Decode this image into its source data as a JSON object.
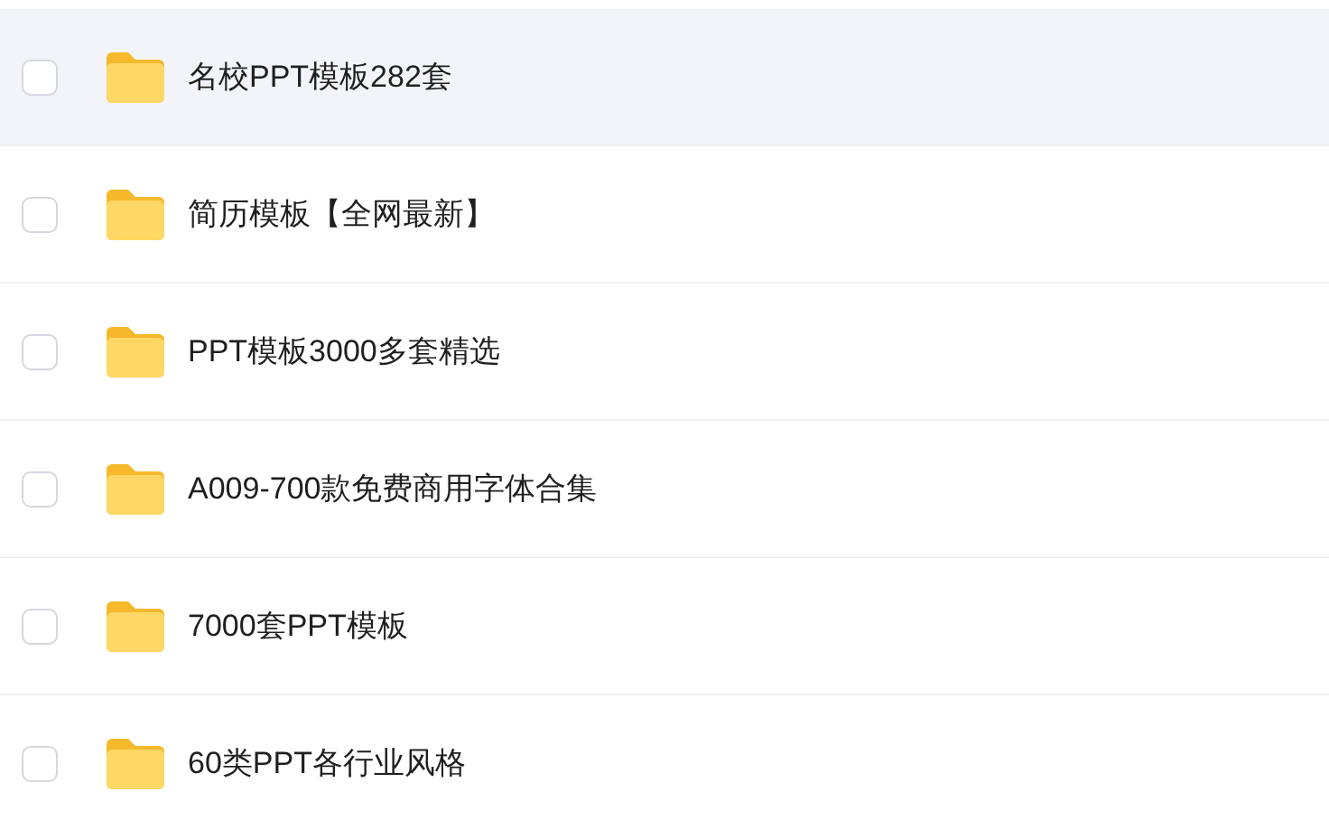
{
  "folders": [
    {
      "name": "名校PPT模板282套",
      "checked": false,
      "highlighted": true
    },
    {
      "name": "简历模板【全网最新】",
      "checked": false,
      "highlighted": false
    },
    {
      "name": "PPT模板3000多套精选",
      "checked": false,
      "highlighted": false
    },
    {
      "name": "A009-700款免费商用字体合集",
      "checked": false,
      "highlighted": false
    },
    {
      "name": "7000套PPT模板",
      "checked": false,
      "highlighted": false
    },
    {
      "name": "60类PPT各行业风格",
      "checked": false,
      "highlighted": false
    }
  ]
}
